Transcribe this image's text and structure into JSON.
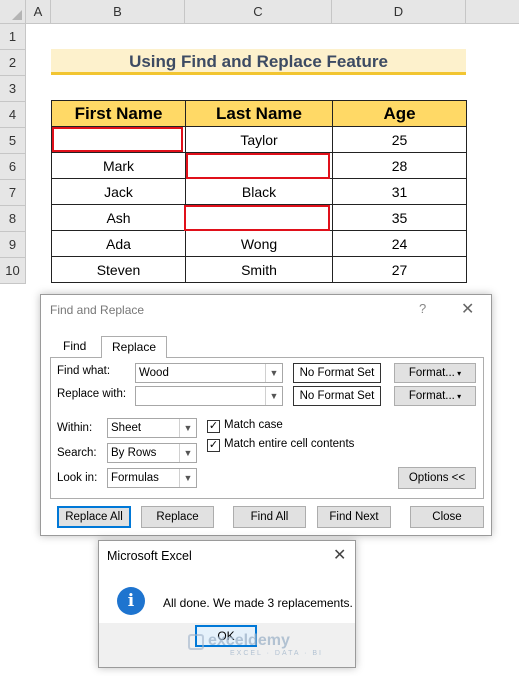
{
  "columns": [
    "A",
    "B",
    "C",
    "D"
  ],
  "rows": [
    "1",
    "2",
    "3",
    "4",
    "5",
    "6",
    "7",
    "8",
    "9",
    "10"
  ],
  "sheet_title": "Using Find and Replace Feature",
  "table": {
    "headers": [
      "First Name",
      "Last Name",
      "Age"
    ],
    "rows": [
      [
        "",
        "Taylor",
        "25"
      ],
      [
        "Mark",
        "",
        "28"
      ],
      [
        "Jack",
        "Black",
        "31"
      ],
      [
        "Ash",
        "",
        "35"
      ],
      [
        "Ada",
        "Wong",
        "24"
      ],
      [
        "Steven",
        "Smith",
        "27"
      ]
    ]
  },
  "dialog": {
    "title": "Find and Replace",
    "help": "?",
    "close": "✕",
    "tabs": [
      "Find",
      "Replace"
    ],
    "find_label": "Find what:",
    "find_value": "Wood",
    "replace_label": "Replace with:",
    "replace_value": "",
    "no_format": "No Format Set",
    "format_btn": "Format...",
    "within_label": "Within:",
    "within_value": "Sheet",
    "search_label": "Search:",
    "search_value": "By Rows",
    "lookin_label": "Look in:",
    "lookin_value": "Formulas",
    "match_case": "Match case",
    "match_entire": "Match entire cell contents",
    "options_btn": "Options <<",
    "buttons": [
      "Replace All",
      "Replace",
      "Find All",
      "Find Next",
      "Close"
    ]
  },
  "message": {
    "title": "Microsoft Excel",
    "close": "✕",
    "icon": "info-icon",
    "text": "All done. We made 3 replacements.",
    "ok": "OK"
  },
  "watermark": {
    "name": "exceldemy",
    "tagline": "EXCEL · DATA · BI"
  },
  "colors": {
    "header_fill": "#ffd966",
    "title_fill": "#fdf1cc",
    "title_underline": "#f2c531",
    "highlight_border": "#e0101a",
    "accent": "#0078d7"
  }
}
